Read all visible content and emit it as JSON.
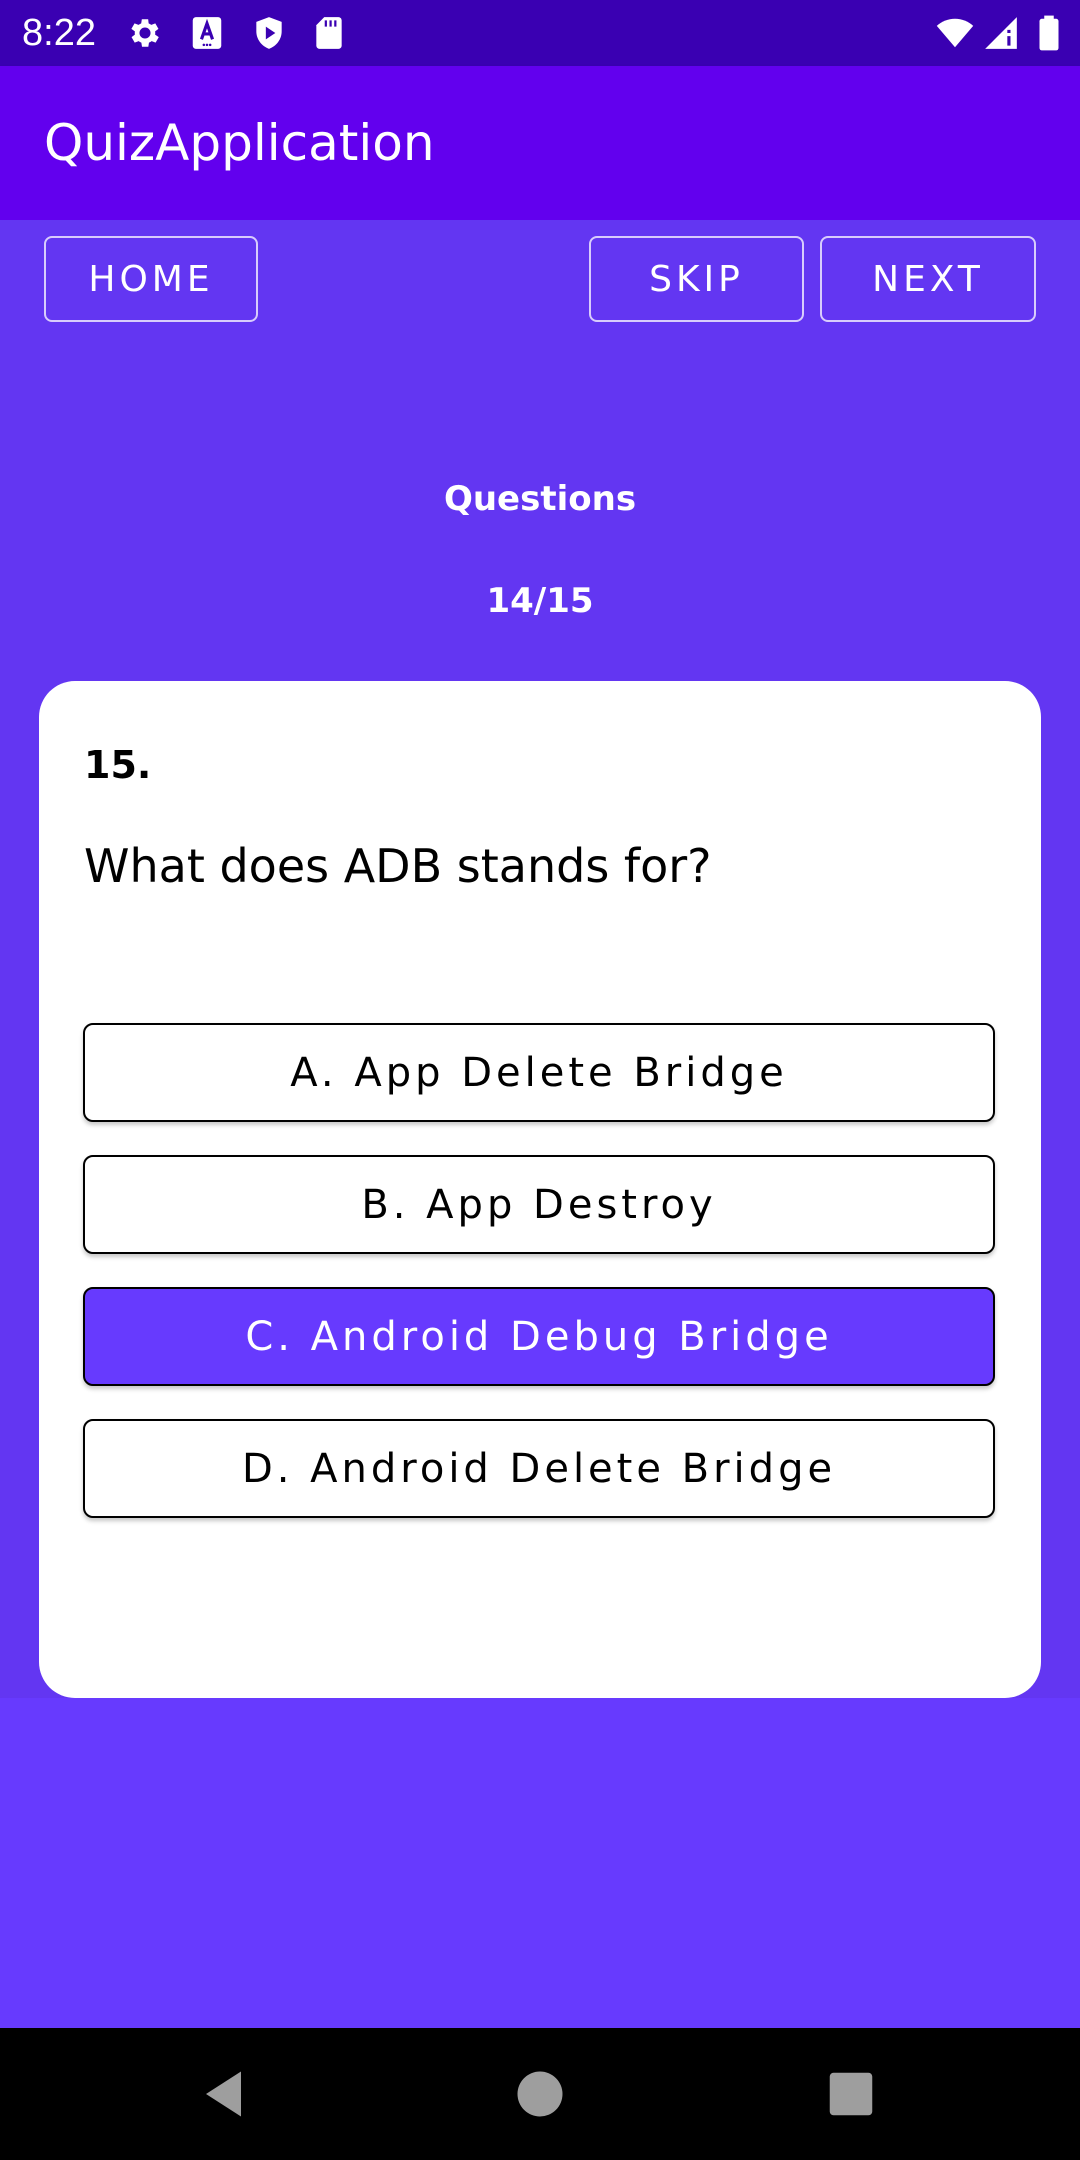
{
  "status_bar": {
    "time": "8:22",
    "icons": [
      "gear-icon",
      "font-a-icon",
      "shield-play-icon",
      "sd-card-icon",
      "wifi-icon",
      "signal-icon",
      "battery-icon"
    ]
  },
  "app_bar": {
    "title": "QuizApplication"
  },
  "toolbar": {
    "home_label": "HOME",
    "skip_label": "SKIP",
    "next_label": "NEXT"
  },
  "progress": {
    "label": "Questions",
    "value": "14/15"
  },
  "question": {
    "number": "15.",
    "text": "What does ADB stands for?",
    "options": [
      {
        "label": "A. App Delete Bridge",
        "selected": false
      },
      {
        "label": "B. App Destroy",
        "selected": false
      },
      {
        "label": "C. Android Debug Bridge",
        "selected": true
      },
      {
        "label": "D. Android Delete Bridge",
        "selected": false
      }
    ]
  },
  "nav_bar": {
    "icons": [
      "back-icon",
      "home-circle-icon",
      "recents-icon"
    ]
  },
  "colors": {
    "status_bar": "#3A00B2",
    "app_bar": "#6200EE",
    "background": "#673AFE",
    "card": "#FFFFFF",
    "selected_option": "#673AFE"
  }
}
